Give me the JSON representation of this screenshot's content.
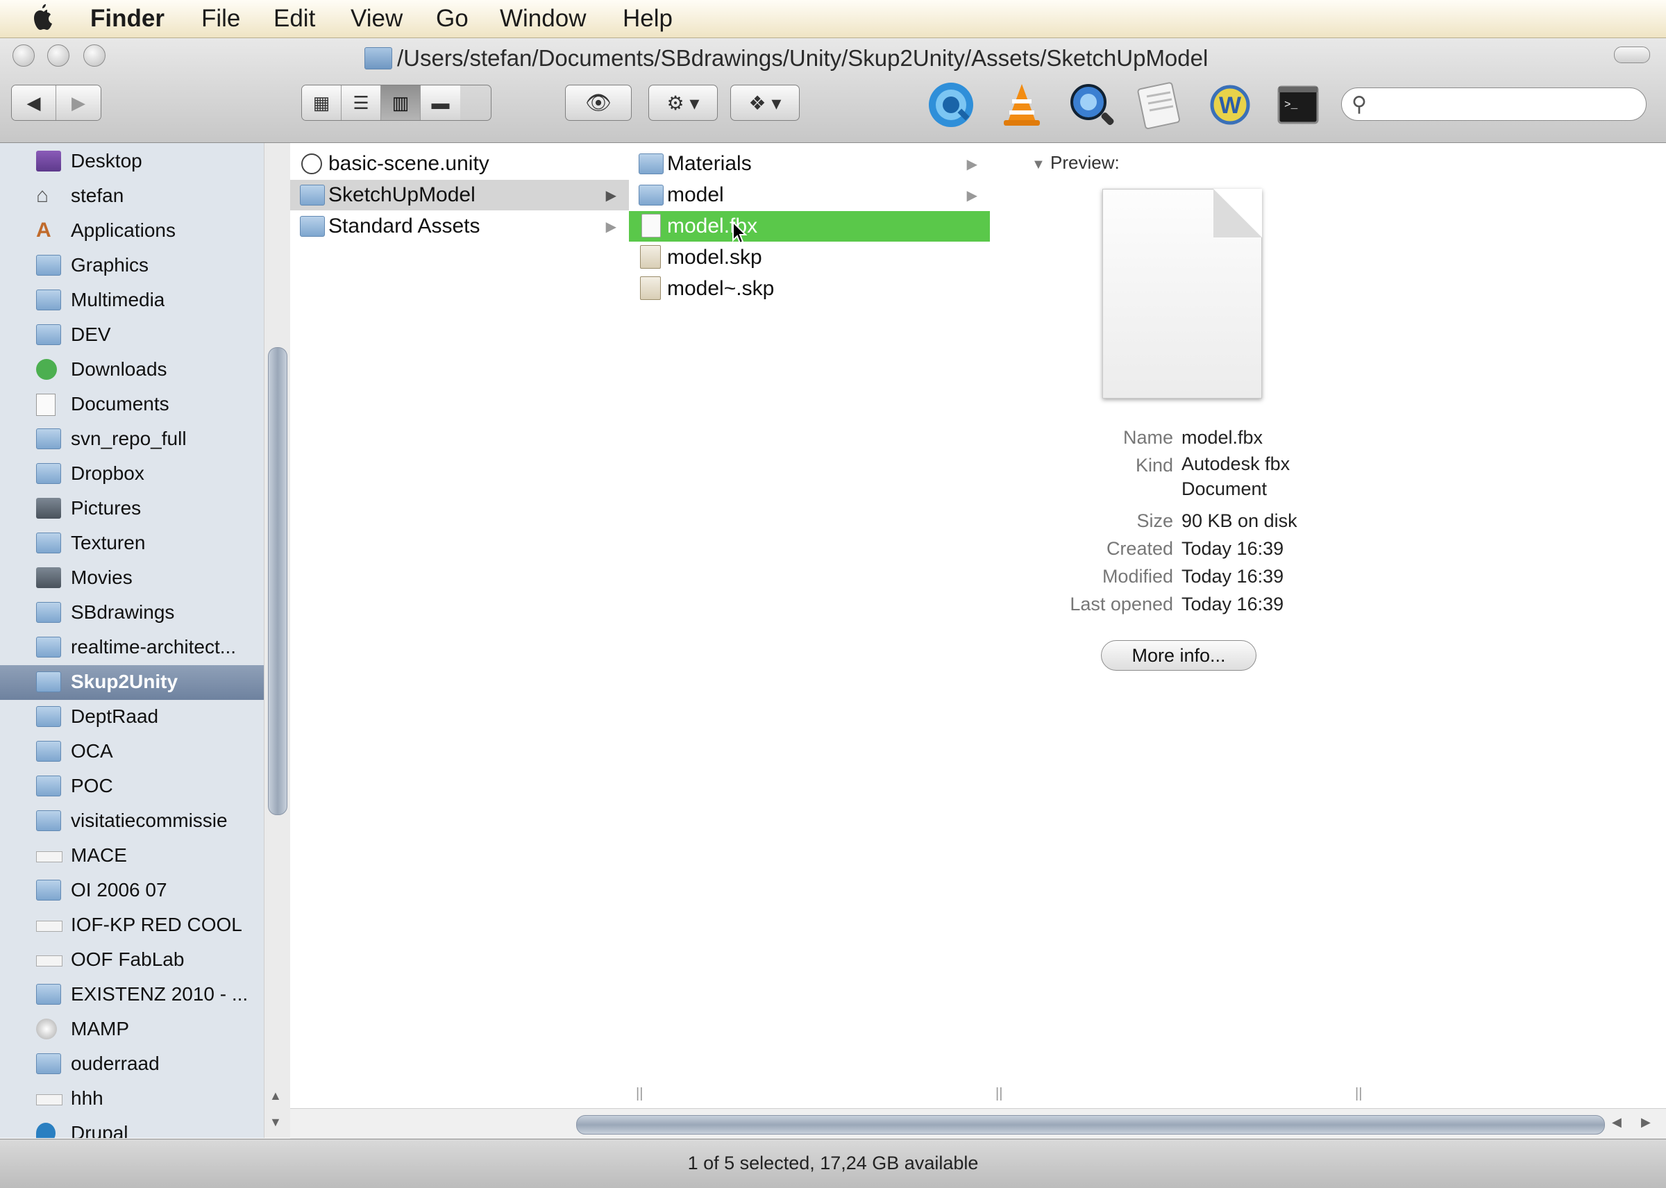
{
  "menubar": {
    "apple": "",
    "items": [
      "Finder",
      "File",
      "Edit",
      "View",
      "Go",
      "Window",
      "Help"
    ]
  },
  "window": {
    "title": "/Users/stefan/Documents/SBdrawings/Unity/Skup2Unity/Assets/SketchUpModel"
  },
  "toolbar": {
    "back": "◀",
    "forward": "▶",
    "view_icons": "▦",
    "view_list": "☰",
    "view_columns": "▥",
    "view_coverflow": "▬",
    "quicklook": "👁",
    "action": "⚙ ▾",
    "dropbox": "❖ ▾",
    "search_placeholder": ""
  },
  "sidebar": {
    "items": [
      {
        "label": "Desktop",
        "icon": "desktop-icon"
      },
      {
        "label": "stefan",
        "icon": "home-icon"
      },
      {
        "label": "Applications",
        "icon": "applications-icon"
      },
      {
        "label": "Graphics",
        "icon": "folder-icon"
      },
      {
        "label": "Multimedia",
        "icon": "folder-icon"
      },
      {
        "label": "DEV",
        "icon": "folder-icon"
      },
      {
        "label": "Downloads",
        "icon": "downloads-icon"
      },
      {
        "label": "Documents",
        "icon": "documents-icon"
      },
      {
        "label": "svn_repo_full",
        "icon": "folder-icon"
      },
      {
        "label": "Dropbox",
        "icon": "folder-icon"
      },
      {
        "label": "Pictures",
        "icon": "pictures-icon"
      },
      {
        "label": "Texturen",
        "icon": "folder-icon"
      },
      {
        "label": "Movies",
        "icon": "movies-icon"
      },
      {
        "label": "SBdrawings",
        "icon": "folder-icon"
      },
      {
        "label": "realtime-architect...",
        "icon": "folder-icon"
      },
      {
        "label": "Skup2Unity",
        "icon": "folder-icon",
        "selected": true
      },
      {
        "label": "DeptRaad",
        "icon": "folder-icon"
      },
      {
        "label": "OCA",
        "icon": "folder-icon"
      },
      {
        "label": "POC",
        "icon": "folder-icon"
      },
      {
        "label": "visitatiecommissie",
        "icon": "folder-icon"
      },
      {
        "label": "MACE",
        "icon": "file-icon"
      },
      {
        "label": "OI 2006 07",
        "icon": "folder-icon"
      },
      {
        "label": "IOF-KP RED COOL",
        "icon": "file-icon"
      },
      {
        "label": "OOF FabLab",
        "icon": "file-icon"
      },
      {
        "label": "EXISTENZ 2010 - ...",
        "icon": "folder-icon"
      },
      {
        "label": "MAMP",
        "icon": "mamp-icon"
      },
      {
        "label": "ouderraad",
        "icon": "folder-icon"
      },
      {
        "label": "hhh",
        "icon": "file-icon"
      },
      {
        "label": "Drupal",
        "icon": "drupal-icon"
      }
    ]
  },
  "columns": {
    "col1": [
      {
        "label": "basic-scene.unity",
        "icon": "unity-file-icon"
      },
      {
        "label": "SketchUpModel",
        "icon": "folder-icon",
        "arrow": "▶",
        "path": true
      },
      {
        "label": "Standard Assets",
        "icon": "folder-icon",
        "arrow": "▶"
      }
    ],
    "col2": [
      {
        "label": "Materials",
        "icon": "folder-icon",
        "arrow": "▶"
      },
      {
        "label": "model",
        "icon": "folder-icon",
        "arrow": "▶"
      },
      {
        "label": "model.fbx",
        "icon": "document-icon",
        "selected": true
      },
      {
        "label": "model.skp",
        "icon": "skp-file-icon"
      },
      {
        "label": "model~.skp",
        "icon": "skp-file-icon"
      }
    ]
  },
  "preview": {
    "header": "Preview:",
    "info": [
      {
        "key": "Name",
        "value": "model.fbx"
      },
      {
        "key": "Kind",
        "value": "Autodesk fbx Document"
      },
      {
        "key": "Size",
        "value": "90 KB on disk"
      },
      {
        "key": "Created",
        "value": "Today 16:39"
      },
      {
        "key": "Modified",
        "value": "Today 16:39"
      },
      {
        "key": "Last opened",
        "value": "Today 16:39"
      }
    ],
    "more_info": "More info..."
  },
  "status": "1 of 5 selected, 17,24 GB available",
  "colors": {
    "selection_green": "#5ac84a",
    "sidebar_bg": "#dfe5ec",
    "sidebar_selected": "#7b8ea9"
  }
}
